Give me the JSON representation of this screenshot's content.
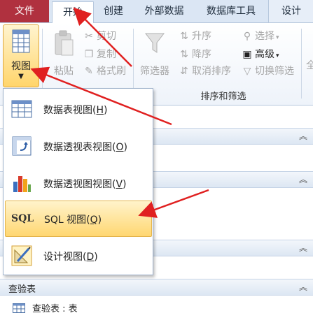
{
  "tabs": {
    "file": "文件",
    "home": "开始",
    "create": "创建",
    "external": "外部数据",
    "dbtools": "数据库工具",
    "design": "设计"
  },
  "ribbon": {
    "view": "视图",
    "paste": "粘贴",
    "cut": "剪切",
    "copy": "复制",
    "format_painter": "格式刷",
    "filter": "筛选器",
    "asc": "升序",
    "desc": "降序",
    "clear_sort": "取消排序",
    "select": "选择",
    "advanced": "高级",
    "toggle_filter": "切换筛选",
    "group_sort_filter": "排序和筛选",
    "partial_all": "全"
  },
  "view_menu": {
    "items": [
      {
        "label": "数据表视图(",
        "key": "H",
        "tail": ")"
      },
      {
        "label": "数据透视表视图(",
        "key": "O",
        "tail": ")"
      },
      {
        "label": "数据透视图视图(",
        "key": "V",
        "tail": ")"
      },
      {
        "label": "SQL 视图(",
        "key": "Q",
        "tail": ")"
      },
      {
        "label": "设计视图(",
        "key": "D",
        "tail": ")"
      }
    ],
    "sql_icon_text": "SQL"
  },
  "nav": {
    "section_query": "查验表",
    "query_item": "查验表 : 表"
  },
  "colors": {
    "file_tab": "#b0313f",
    "highlight": "#ffd771",
    "arrow": "#e02020"
  }
}
